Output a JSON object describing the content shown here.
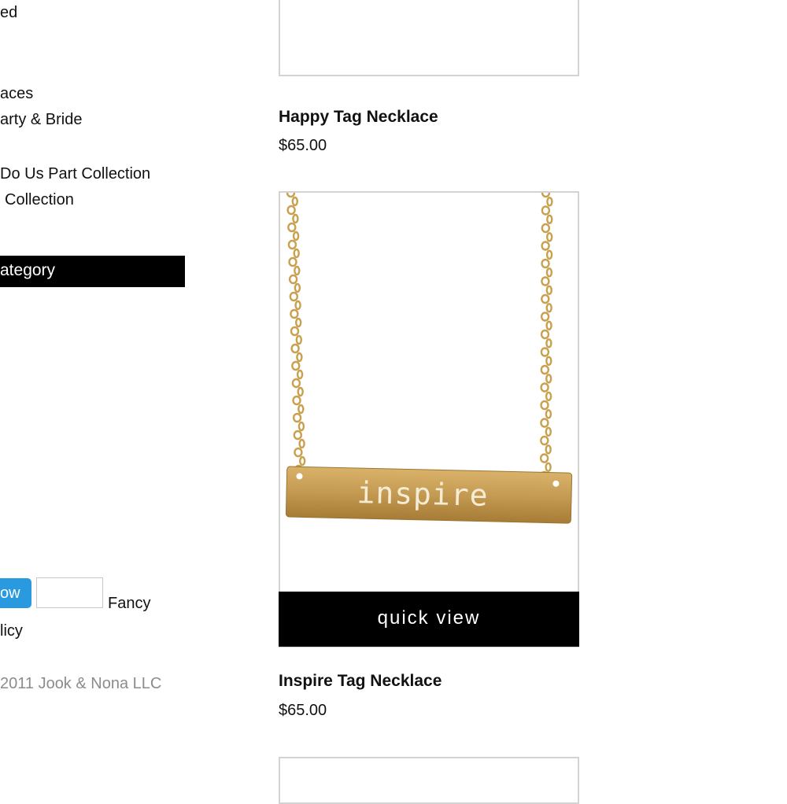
{
  "sidebar": {
    "line1": "ed",
    "line2": "aces",
    "line3": "arty & Bride",
    "line4": "Do Us Part Collection",
    "line5": "Collection",
    "category_label": "ategory",
    "follow_label": "ow",
    "fancy_label": "Fancy",
    "policy_label": "licy",
    "copyright": "2011 Jook & Nona LLC"
  },
  "products": [
    {
      "name": "Happy Tag Necklace",
      "price": "$65.00"
    },
    {
      "name": "Inspire Tag Necklace",
      "price": "$65.00",
      "engraving": "inspire",
      "quick_view": "quick view"
    }
  ],
  "colors": {
    "gold": "#c9a04e",
    "follow": "#2a9ae0",
    "black": "#000000"
  }
}
